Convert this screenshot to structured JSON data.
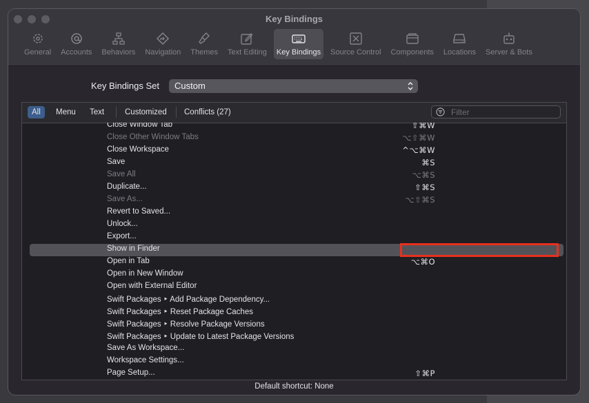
{
  "window": {
    "title": "Key Bindings"
  },
  "toolbar": {
    "tabs": [
      {
        "label": "General",
        "icon": "gear-icon"
      },
      {
        "label": "Accounts",
        "icon": "at-sign-icon"
      },
      {
        "label": "Behaviors",
        "icon": "hierarchy-icon"
      },
      {
        "label": "Navigation",
        "icon": "navigation-diamond-icon"
      },
      {
        "label": "Themes",
        "icon": "paintbrush-icon"
      },
      {
        "label": "Text Editing",
        "icon": "pencil-square-icon"
      },
      {
        "label": "Key Bindings",
        "icon": "keyboard-icon",
        "active": true
      },
      {
        "label": "Source Control",
        "icon": "source-control-icon"
      },
      {
        "label": "Components",
        "icon": "components-icon"
      },
      {
        "label": "Locations",
        "icon": "drive-icon"
      },
      {
        "label": "Server & Bots",
        "icon": "robot-icon"
      }
    ]
  },
  "key_bindings_set": {
    "label": "Key Bindings Set",
    "value": "Custom"
  },
  "filters": {
    "all": "All",
    "menu": "Menu",
    "text": "Text",
    "customized": "Customized",
    "conflicts": "Conflicts (27)",
    "search_placeholder": "Filter"
  },
  "bindings": [
    {
      "command": "Close Window Tab",
      "key": "⇧⌘W"
    },
    {
      "command": "Close Other Window Tabs",
      "key": "⌥⇧⌘W",
      "dim": true
    },
    {
      "command": "Close Workspace",
      "key": "^⌥⌘W"
    },
    {
      "command": "Save",
      "key": "⌘S"
    },
    {
      "command": "Save All",
      "key": "⌥⌘S",
      "dim": true
    },
    {
      "command": "Duplicate...",
      "key": "⇧⌘S"
    },
    {
      "command": "Save As...",
      "key": "⌥⇧⌘S",
      "dim": true
    },
    {
      "command": "Revert to Saved...",
      "key": ""
    },
    {
      "command": "Unlock...",
      "key": ""
    },
    {
      "command": "Export...",
      "key": ""
    },
    {
      "command": "Show in Finder",
      "key": "",
      "selected": true
    },
    {
      "command": "Open in Tab",
      "key": "⌥⌘O"
    },
    {
      "command": "Open in New Window",
      "key": ""
    },
    {
      "command": "Open with External Editor",
      "key": ""
    },
    {
      "command": "Swift Packages ‣ Add Package Dependency...",
      "key": ""
    },
    {
      "command": "Swift Packages ‣ Reset Package Caches",
      "key": ""
    },
    {
      "command": "Swift Packages ‣ Resolve Package Versions",
      "key": ""
    },
    {
      "command": "Swift Packages ‣ Update to Latest Package Versions",
      "key": ""
    },
    {
      "command": "Save As Workspace...",
      "key": ""
    },
    {
      "command": "Workspace Settings...",
      "key": ""
    },
    {
      "command": "Page Setup...",
      "key": "⇧⌘P"
    }
  ],
  "status": {
    "text": "Default shortcut: None"
  },
  "colors": {
    "accent": "#3c5e8c",
    "highlight": "#e8301c",
    "window_bg": "#29272d"
  }
}
